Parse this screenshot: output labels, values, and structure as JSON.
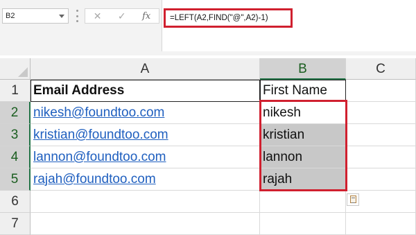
{
  "name_box": {
    "value": "B2"
  },
  "formula_bar": {
    "cancel_symbol": "✕",
    "enter_symbol": "✓",
    "function_symbol": "fx",
    "formula": "=LEFT(A2,FIND(\"@\",A2)-1)"
  },
  "columns": [
    "A",
    "B",
    "C"
  ],
  "rows": [
    "1",
    "2",
    "3",
    "4",
    "5",
    "6",
    "7"
  ],
  "cells": {
    "A1": "Email Address",
    "B1": "First Name",
    "A2": "nikesh@foundtoo.com",
    "B2": "nikesh",
    "A3": "kristian@foundtoo.com",
    "B3": "kristian",
    "A4": "lannon@foundtoo.com",
    "B4": "lannon",
    "A5": "rajah@foundtoo.com",
    "B5": "rajah"
  },
  "colors": {
    "highlight_border": "#d0202f",
    "link": "#1f5fbf",
    "selection_fill": "#c8c8c8",
    "selected_header": "#217346"
  },
  "icons": {
    "name_box_dropdown": "chevron-down-icon",
    "quick_analysis": "paste-options-icon"
  }
}
